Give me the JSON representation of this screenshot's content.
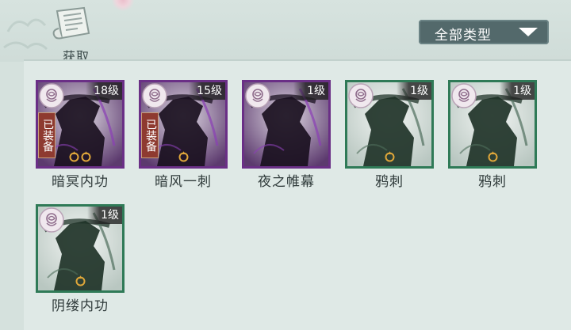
{
  "header": {
    "fetch_label": "获取",
    "filter_label": "全部类型"
  },
  "colors": {
    "accent_purple": "#6a2f86",
    "accent_green": "#2f7a57",
    "equipped_badge": "#8e3a30",
    "filter_bg": "#53696b"
  },
  "items": [
    {
      "name": "暗冥内功",
      "level": "18级",
      "rarity": "purple",
      "equipped": "已装备",
      "marks": 2
    },
    {
      "name": "暗风一刺",
      "level": "15级",
      "rarity": "purple",
      "equipped": "已装备",
      "marks": 1
    },
    {
      "name": "夜之帷幕",
      "level": "1级",
      "rarity": "purple",
      "equipped": "",
      "marks": 0
    },
    {
      "name": "鸦刺",
      "level": "1级",
      "rarity": "green",
      "equipped": "",
      "marks": 1
    },
    {
      "name": "鸦刺",
      "level": "1级",
      "rarity": "green",
      "equipped": "",
      "marks": 1
    },
    {
      "name": "阴缕内功",
      "level": "1级",
      "rarity": "green",
      "equipped": "",
      "marks": 1
    }
  ]
}
